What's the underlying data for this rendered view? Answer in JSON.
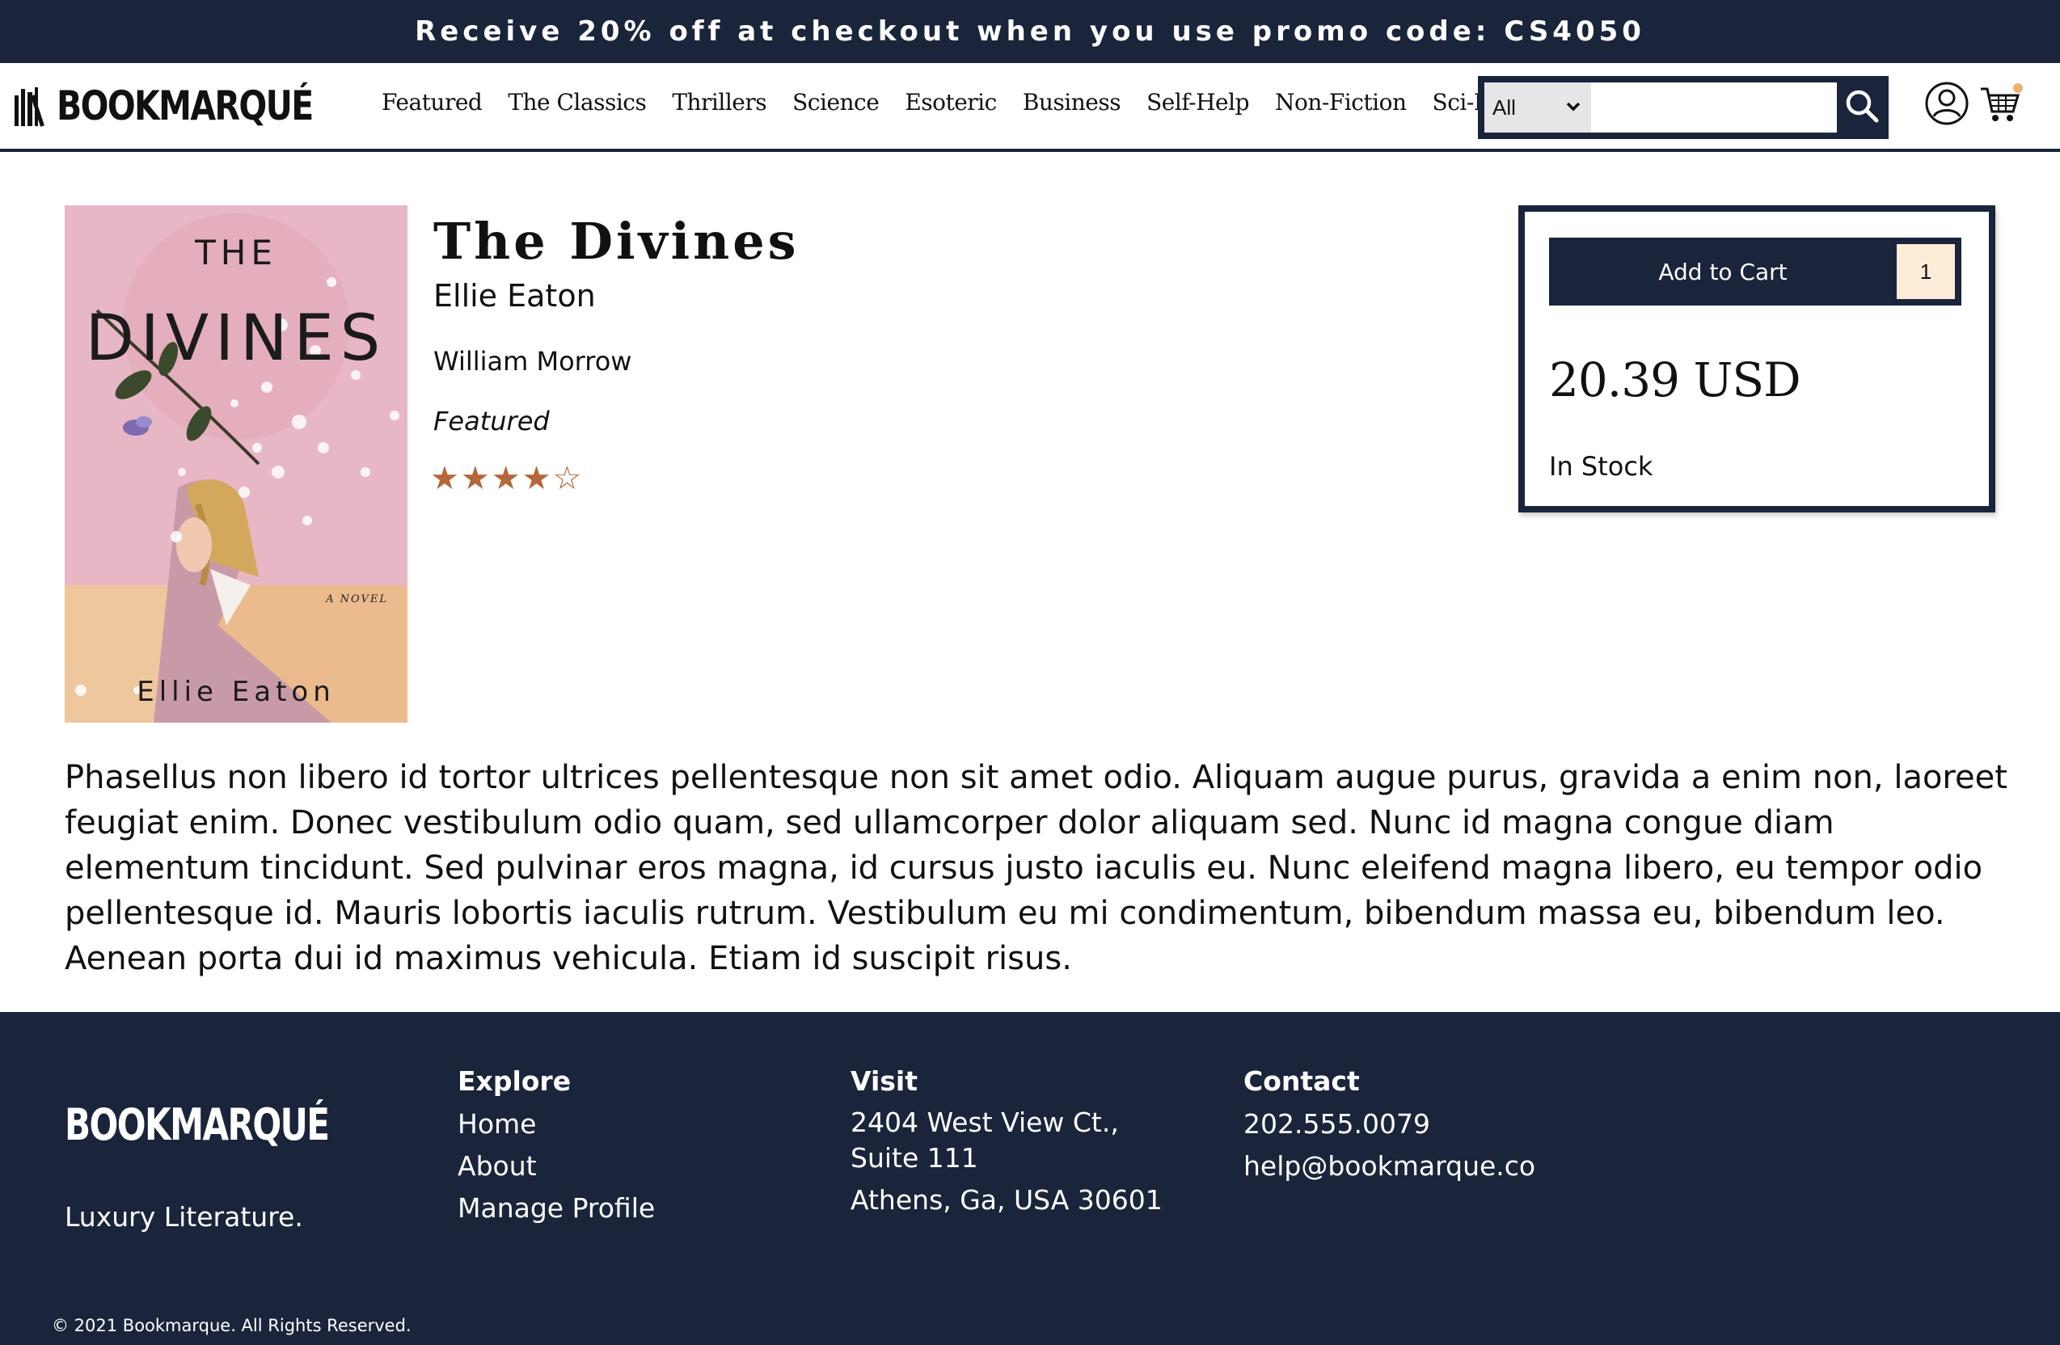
{
  "promo": {
    "text": "Receive 20% off at checkout when you use promo code: CS4050"
  },
  "header": {
    "logo_text": "BOOKMARQUÉ",
    "nav": [
      "Featured",
      "The Classics",
      "Thrillers",
      "Science",
      "Esoteric",
      "Business",
      "Self-Help",
      "Non-Fiction",
      "Sci-Fi"
    ],
    "search": {
      "category_selected": "All",
      "query": ""
    }
  },
  "product": {
    "cover": {
      "title_top": "THE",
      "title_main": "DIVINES",
      "tagline": "A NOVEL",
      "author": "Ellie Eaton"
    },
    "title": "The Divines",
    "author": "Ellie Eaton",
    "publisher": "William Morrow",
    "category": "Featured",
    "rating": {
      "value": 4,
      "max": 5,
      "filled_char": "★",
      "empty_char": "☆"
    },
    "buybox": {
      "add_to_cart_label": "Add to Cart",
      "quantity": "1",
      "price": "20.39 USD",
      "availability": "In Stock"
    },
    "description": "Phasellus non libero id tortor ultrices pellentesque non sit amet odio. Aliquam augue purus, gravida a enim non, laoreet feugiat enim. Donec vestibulum odio quam, sed ullamcorper dolor aliquam sed. Nunc id magna congue diam elementum tincidunt. Sed pulvinar eros magna, id cursus justo iaculis eu. Nunc eleifend magna libero, eu tempor odio pellentesque id. Mauris lobortis iaculis rutrum. Vestibulum eu mi condimentum, bibendum massa eu, bibendum leo. Aenean porta dui id maximus vehicula. Etiam id suscipit risus."
  },
  "footer": {
    "logo_text": "BOOKMARQUÉ",
    "tagline": "Luxury Literature.",
    "explore": {
      "heading": "Explore",
      "links": [
        "Home",
        "About",
        "Manage Profile"
      ]
    },
    "visit": {
      "heading": "Visit",
      "address_line1": "2404 West View Ct., Suite 111",
      "address_line2": "Athens, Ga, USA 30601"
    },
    "contact": {
      "heading": "Contact",
      "phone": "202.555.0079",
      "email": "help@bookmarque.co"
    },
    "copyright": "© 2021 Bookmarque. All Rights Reserved."
  },
  "colors": {
    "navy": "#1a253c",
    "star": "#b5663a",
    "qty_bg": "#fcecd8",
    "cover_pink": "#e8b7c5",
    "cart_dot": "#f0b070"
  },
  "icons": {
    "search": "search-icon",
    "user": "user-icon",
    "cart": "cart-icon",
    "dropdown": "chevron-down-icon"
  }
}
